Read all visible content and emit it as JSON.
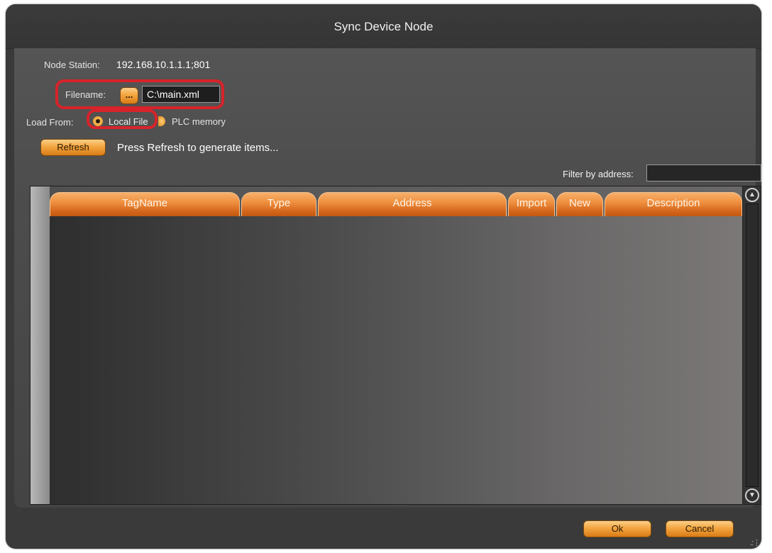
{
  "window": {
    "title": "Sync Device Node"
  },
  "node_station": {
    "label": "Node Station:",
    "value": "192.168.10.1.1.1;801"
  },
  "filename": {
    "label": "Filename:",
    "browse_label": "...",
    "value": "C:\\main.xml"
  },
  "load_from": {
    "label": "Load From:",
    "options": [
      {
        "label": "Local File",
        "selected": true
      },
      {
        "label": "PLC memory",
        "selected": false
      }
    ]
  },
  "refresh": {
    "button_label": "Refresh",
    "hint": "Press Refresh to generate items..."
  },
  "filter": {
    "label": "Filter by address:",
    "value": ""
  },
  "grid": {
    "columns": [
      "TagName",
      "Type",
      "Address",
      "Import",
      "New",
      "Description"
    ],
    "rows": []
  },
  "footer": {
    "ok_label": "Ok",
    "cancel_label": "Cancel"
  },
  "colors": {
    "highlight": "#d8232a",
    "accent": "#f09040"
  }
}
